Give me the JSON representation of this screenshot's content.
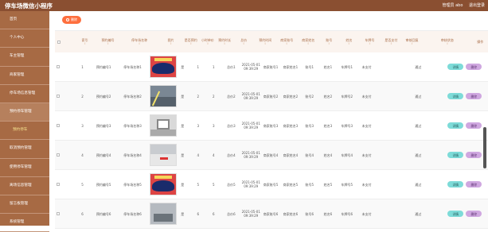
{
  "header": {
    "title": "停车场微信小程序",
    "user_label": "管理员 abo",
    "logout_label": "退出登录"
  },
  "sidebar": {
    "items": [
      {
        "label": "首页",
        "active": false,
        "sub": false
      },
      {
        "label": "个人中心",
        "active": false,
        "sub": false
      },
      {
        "label": "车主管理",
        "active": false,
        "sub": false
      },
      {
        "label": "商家管理",
        "active": false,
        "sub": false
      },
      {
        "label": "停车场信息管理",
        "active": false,
        "sub": false
      },
      {
        "label": "预约停车管理",
        "active": true,
        "sub": false
      },
      {
        "label": "预约停车",
        "active": false,
        "sub": true
      },
      {
        "label": "取消预约管理",
        "active": false,
        "sub": false
      },
      {
        "label": "使用停车管理",
        "active": false,
        "sub": false
      },
      {
        "label": "离场信息管理",
        "active": false,
        "sub": false
      },
      {
        "label": "留言板管理",
        "active": false,
        "sub": false
      },
      {
        "label": "系统管理",
        "active": false,
        "sub": false
      }
    ]
  },
  "toolbar": {
    "delete_label": "删除"
  },
  "table": {
    "columns": [
      "索引",
      "预约编号",
      "停车场名称",
      "图片",
      "是否预约",
      "小时单价",
      "预约时长",
      "总价",
      "预约时间",
      "商家账号",
      "商家姓名",
      "账号",
      "姓名",
      "车牌号",
      "是否支付",
      "审核回复",
      "审核状态",
      "操作"
    ],
    "detail_label": "详情",
    "delete_label": "删除",
    "rows": [
      {
        "idx": "1",
        "code": "预约编号1",
        "lot": "停车场名称1",
        "img": "car",
        "reserved": "是",
        "price": "1",
        "hours": "1",
        "total": "总价1",
        "time": "2021-05-01 09:39:29",
        "maccount": "商家账号1",
        "mname": "商家姓名1",
        "account": "账号1",
        "name": "姓名1",
        "plate": "车牌号1",
        "paid": "未支付",
        "reply": "",
        "status": "通过"
      },
      {
        "idx": "2",
        "code": "预约编号2",
        "lot": "停车场名称2",
        "img": "lot",
        "reserved": "是",
        "price": "2",
        "hours": "2",
        "total": "总价2",
        "time": "2021-05-01 09:39:29",
        "maccount": "商家账号2",
        "mname": "商家姓名2",
        "account": "账号2",
        "name": "姓名2",
        "plate": "车牌号2",
        "paid": "未支付",
        "reply": "",
        "status": "通过"
      },
      {
        "idx": "3",
        "code": "预约编号3",
        "lot": "停车场名称3",
        "img": "gar",
        "reserved": "是",
        "price": "3",
        "hours": "3",
        "total": "总价3",
        "time": "2021-05-01 09:39:29",
        "maccount": "商家账号3",
        "mname": "商家姓名3",
        "account": "账号3",
        "name": "姓名3",
        "plate": "车牌号3",
        "paid": "未支付",
        "reply": "",
        "status": "通过"
      },
      {
        "idx": "4",
        "code": "预约编号4",
        "lot": "停车场名称4",
        "img": "spc",
        "reserved": "是",
        "price": "4",
        "hours": "4",
        "total": "总价4",
        "time": "2021-05-01 09:39:29",
        "maccount": "商家账号4",
        "mname": "商家姓名4",
        "account": "账号4",
        "name": "姓名4",
        "plate": "车牌号4",
        "paid": "未支付",
        "reply": "",
        "status": "通过"
      },
      {
        "idx": "5",
        "code": "预约编号5",
        "lot": "停车场名称5",
        "img": "car",
        "reserved": "是",
        "price": "5",
        "hours": "5",
        "total": "总价5",
        "time": "2021-05-01 09:39:29",
        "maccount": "商家账号5",
        "mname": "商家姓名5",
        "account": "账号5",
        "name": "姓名5",
        "plate": "车牌号5",
        "paid": "未支付",
        "reply": "",
        "status": "通过"
      },
      {
        "idx": "6",
        "code": "预约编号6",
        "lot": "停车场名称6",
        "img": "gray",
        "reserved": "是",
        "price": "6",
        "hours": "6",
        "total": "总价6",
        "time": "2021-05-01 09:39:29",
        "maccount": "商家账号6",
        "mname": "商家姓名6",
        "account": "账号6",
        "name": "姓名6",
        "plate": "车牌号6",
        "paid": "未支付",
        "reply": "",
        "status": "通过"
      }
    ]
  },
  "colors": {
    "header": "#8a4f31",
    "sidebar": "#a76a44",
    "accent": "#fe6f3e",
    "detail": "#7ddbd8",
    "delete": "#cfa7e0"
  }
}
